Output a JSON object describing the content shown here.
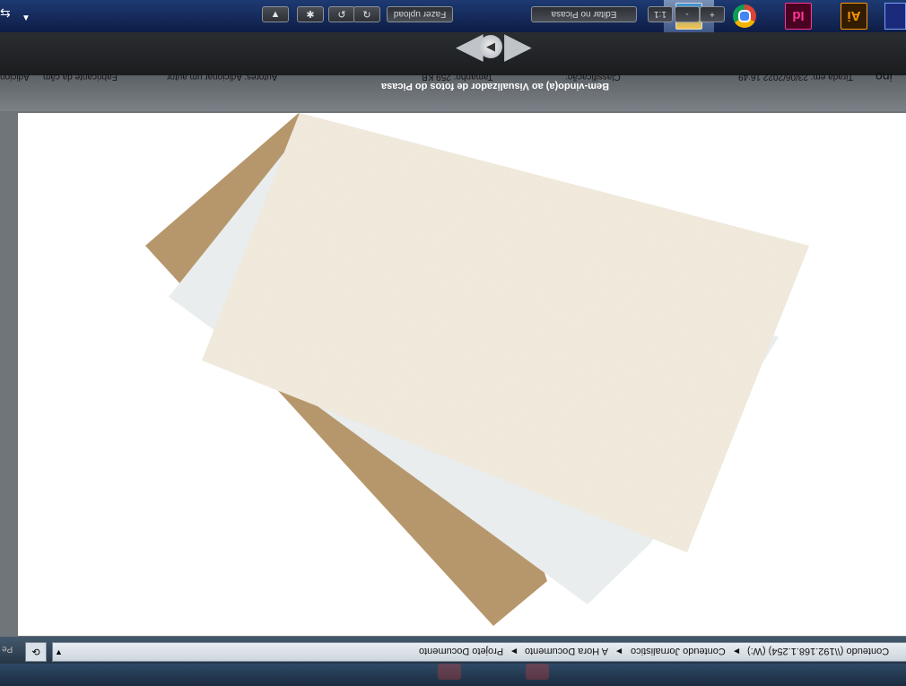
{
  "viewer": {
    "welcome": "Bem-vindo(a) ao Visualizador de fotos do Picasa",
    "buttons": {
      "edit": "Editar no Picasa",
      "upload": "Fazer upload",
      "ratio": "1:1",
      "zoom_out": "-",
      "zoom_in": "+"
    },
    "info": {
      "taken": "Tirada em: 23/06/2022 16:49",
      "classification": "Classificação:",
      "size": "Tamanho: 259 KB",
      "authors": "Autores: Adicionar um autor",
      "camera": "Fabricante da câm",
      "add": "Adicion",
      "left_title": "ino"
    }
  },
  "explorer": {
    "breadcrumb": [
      "Projeto Documento",
      "A Hora Documento",
      "Conteudo Jornalistico",
      "(W:)"
    ],
    "path_tail": "Conteudo (\\\\192.168.1.254) (W:)",
    "left_cut": "Pe"
  },
  "taskbar": {
    "apps": [
      {
        "name": "Picasa",
        "active": true
      },
      {
        "name": "Chrome",
        "active": false
      },
      {
        "name": "InDesign",
        "label": "Id",
        "active": false
      },
      {
        "name": "Illustrator",
        "label": "Ai",
        "active": false
      },
      {
        "name": "Other",
        "active": false
      }
    ]
  },
  "colors": {
    "taskbar": "#14285a",
    "viewer_bg": "#1c1f22",
    "canvas": "#ffffff",
    "cardboard": "#b08f64",
    "paper_white": "#e8eded",
    "paper_cream": "#f1ebde"
  }
}
